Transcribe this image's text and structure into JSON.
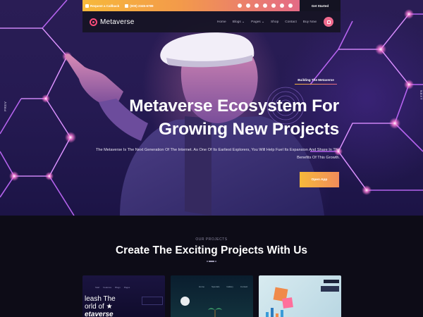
{
  "topbar": {
    "callback": "Request a Callback",
    "phone": "(000) 2345-6789",
    "get_started": "Get Started"
  },
  "nav": {
    "logo": "Metaverse",
    "menu": [
      "Home",
      "Blogs",
      "Pages",
      "Shop",
      "Contact",
      "Buy Now"
    ],
    "colors": {
      "accent": "#ff4d7a",
      "cart": "#f06a8e"
    }
  },
  "hero": {
    "prev": "PREV",
    "next": "NEXT",
    "tag": "Building The Metaverse",
    "title_line1": "Metaverse Ecosystem For",
    "title_line2": "Growing New Projects",
    "description_line1": "The Metaverse Is The Next Generation Of The Internet. As One Of Its Earliest Explorers, You Will Help Fuel Its Expansion And Share In The",
    "description_line2": "Benefits Of This Growth.",
    "cta": "Open App"
  },
  "projects": {
    "eyebrow": "OUR PROJECTS",
    "title": "Create The Exciting Projects With Us",
    "card1": {
      "nav": [
        "Start",
        "Features",
        "Blogs",
        "Pages"
      ],
      "line1": "leash The",
      "line2": "orld of ★",
      "line3": "etaverse"
    },
    "card2": {
      "nav": [
        "Home",
        "Specials",
        "Gallery",
        "Contact"
      ]
    }
  }
}
